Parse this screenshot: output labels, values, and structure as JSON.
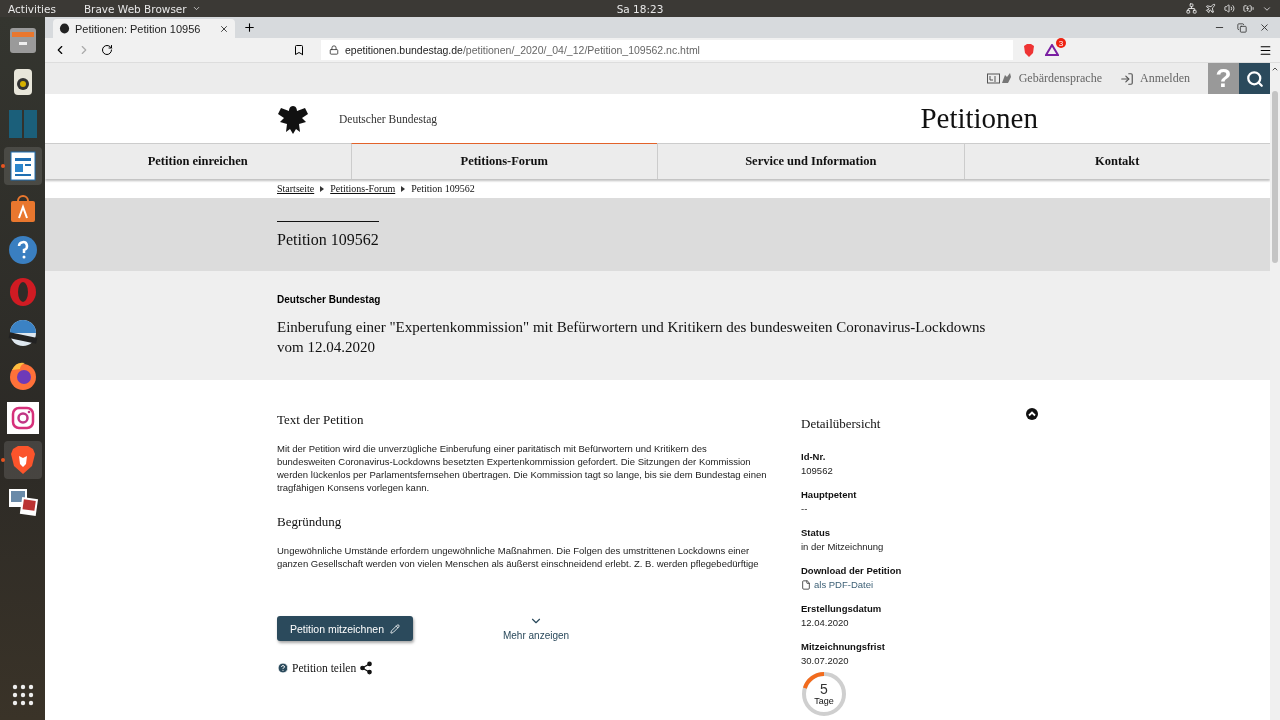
{
  "top_bar": {
    "activities": "Activities",
    "app_menu": "Brave Web Browser",
    "clock": "Sa 18:23"
  },
  "dock": {
    "apps": [
      {
        "kind": "files",
        "running": false
      },
      {
        "kind": "speaker",
        "running": false
      },
      {
        "kind": "panels",
        "running": false
      },
      {
        "kind": "writer",
        "running": true
      },
      {
        "kind": "store",
        "running": false
      },
      {
        "kind": "help",
        "running": false
      },
      {
        "kind": "opera",
        "running": false
      },
      {
        "kind": "video",
        "running": false
      },
      {
        "kind": "firefox",
        "running": false
      },
      {
        "kind": "camera",
        "running": false
      },
      {
        "kind": "brave",
        "running": true
      },
      {
        "kind": "photos",
        "running": false
      }
    ]
  },
  "browser": {
    "tab_title": "Petitionen: Petition 10956",
    "address_host": "epetitionen.bundestag.de",
    "address_path": "/petitionen/_2020/_04/_12/Petition_109562.nc.html",
    "rewards_badge": "3"
  },
  "utility_bar": {
    "sign_language": "Gebärdensprache",
    "login": "Anmelden",
    "help": "?"
  },
  "header": {
    "institution": "Deutscher Bundestag",
    "site_title": "Petitionen"
  },
  "nav": [
    {
      "label": "Petition einreichen",
      "selected": false
    },
    {
      "label": "Petitions-Forum",
      "selected": true
    },
    {
      "label": "Service und Information",
      "selected": false
    },
    {
      "label": "Kontakt",
      "selected": false
    }
  ],
  "breadcrumbs": [
    {
      "label": "Startseite",
      "link": true
    },
    {
      "label": "Petitions-Forum",
      "link": true
    },
    {
      "label": "Petition 109562",
      "link": false
    }
  ],
  "petition": {
    "heading": "Petition 109562",
    "addressee": "Deutscher Bundestag",
    "title": "Einberufung einer \"Expertenkommission\" mit Befürwortern und Kritikern des bundesweiten Coronavirus-Lockdowns vom 12.04.2020"
  },
  "text_section": {
    "heading": "Text der Petition",
    "body": "Mit der Petition wird die unverzügliche Einberufung einer paritätisch mit Befürwortern und Kritikern des bundesweiten Coronavirus-Lockdowns besetzten Expertenkommission gefordert. Die Sitzungen der Kommission werden lückenlos per Parlamentsfernsehen übertragen. Die Kommission tagt so lange, bis sie dem Bundestag einen tragfähigen Konsens vorlegen kann."
  },
  "reason_section": {
    "heading": "Begründung",
    "body": "Ungewöhnliche Umstände erfordern ungewöhnliche Maßnahmen. Die Folgen des umstrittenen Lockdowns einer ganzen Gesellschaft werden von vielen Menschen als äußerst einschneidend erlebt. Z. B. werden pflegebedürftige"
  },
  "actions": {
    "sign_button": "Petition mitzeichnen",
    "more": "Mehr anzeigen",
    "share": "Petition teilen"
  },
  "details": {
    "heading": "Detailübersicht",
    "items": [
      {
        "kind": "text",
        "label": "Id-Nr.",
        "value": "109562"
      },
      {
        "kind": "text",
        "label": "Hauptpetent",
        "value": "--"
      },
      {
        "kind": "text",
        "label": "Status",
        "value": "in der Mitzeichnung"
      },
      {
        "kind": "link",
        "label": "Download der Petition",
        "value": "als PDF-Datei"
      },
      {
        "kind": "text",
        "label": "Erstellungsdatum",
        "value": "12.04.2020"
      },
      {
        "kind": "text",
        "label": "Mitzeichnungsfrist",
        "value": "30.07.2020"
      }
    ],
    "countdown": {
      "number": "5",
      "unit": "Tage",
      "level": 0.2
    }
  }
}
